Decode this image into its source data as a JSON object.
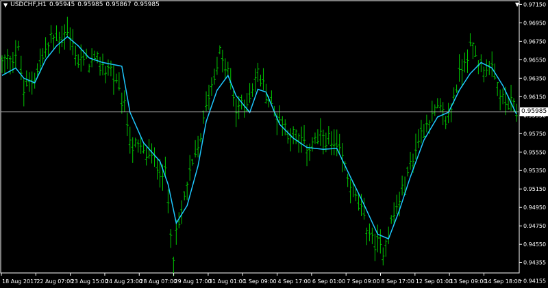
{
  "symbol": {
    "name": "USDCHF,H1",
    "ohlc": [
      "0.95945",
      "0.95985",
      "0.95867",
      "0.95985"
    ]
  },
  "current_price_label": "0.95985",
  "colors": {
    "background": "#000000",
    "bars": "#00c800",
    "moving_average": "#1ec8ff",
    "axis": "#ffffff",
    "price_line": "#c0c0c0"
  },
  "chart_data": {
    "type": "line",
    "title": "USDCHF,H1",
    "xlabel": "",
    "ylabel": "",
    "ylim": [
      0.9424,
      0.9719
    ],
    "current_price": 0.95985,
    "y_ticks": [
      "0.97150",
      "0.96950",
      "0.96750",
      "0.96550",
      "0.96350",
      "0.96150",
      "0.95950",
      "0.95750",
      "0.95550",
      "0.95350",
      "0.95150",
      "0.94950",
      "0.94750",
      "0.94550",
      "0.94355",
      "0.94155"
    ],
    "x_ticks": [
      "18 Aug 2017",
      "22 Aug 07:00",
      "23 Aug 15:00",
      "24 Aug 23:00",
      "28 Aug 07:00",
      "29 Aug 17:00",
      "31 Aug 01:00",
      "1 Sep 09:00",
      "4 Sep 17:00",
      "6 Sep 01:00",
      "7 Sep 09:00",
      "8 Sep 17:00",
      "12 Sep 01:00",
      "13 Sep 09:00",
      "14 Sep 18:00"
    ],
    "series": [
      {
        "name": "",
        "style": "hl_bars",
        "x_range": [
          0,
          189
        ],
        "anchors": [
          [
            0,
            0.965
          ],
          [
            6,
            0.9665
          ],
          [
            8,
            0.962
          ],
          [
            12,
            0.964
          ],
          [
            18,
            0.9675
          ],
          [
            24,
            0.9685
          ],
          [
            28,
            0.9655
          ],
          [
            35,
            0.965
          ],
          [
            40,
            0.9645
          ],
          [
            45,
            0.96
          ],
          [
            48,
            0.956
          ],
          [
            55,
            0.955
          ],
          [
            60,
            0.953
          ],
          [
            63,
            0.9445
          ],
          [
            68,
            0.952
          ],
          [
            72,
            0.956
          ],
          [
            76,
            0.962
          ],
          [
            80,
            0.966
          ],
          [
            83,
            0.964
          ],
          [
            86,
            0.96
          ],
          [
            90,
            0.961
          ],
          [
            94,
            0.964
          ],
          [
            100,
            0.96
          ],
          [
            106,
            0.9575
          ],
          [
            112,
            0.956
          ],
          [
            118,
            0.957
          ],
          [
            124,
            0.9555
          ],
          [
            128,
            0.952
          ],
          [
            132,
            0.949
          ],
          [
            136,
            0.946
          ],
          [
            140,
            0.945
          ],
          [
            143,
            0.948
          ],
          [
            148,
            0.952
          ],
          [
            152,
            0.956
          ],
          [
            156,
            0.959
          ],
          [
            160,
            0.96
          ],
          [
            164,
            0.959
          ],
          [
            168,
            0.964
          ],
          [
            172,
            0.967
          ],
          [
            176,
            0.965
          ],
          [
            180,
            0.964
          ],
          [
            184,
            0.961
          ],
          [
            189,
            0.96
          ]
        ]
      },
      {
        "name": "",
        "style": "line",
        "points": [
          [
            0,
            0.9638
          ],
          [
            5,
            0.9646
          ],
          [
            8,
            0.9635
          ],
          [
            12,
            0.963
          ],
          [
            16,
            0.9655
          ],
          [
            20,
            0.967
          ],
          [
            24,
            0.968
          ],
          [
            28,
            0.967
          ],
          [
            32,
            0.9657
          ],
          [
            37,
            0.9652
          ],
          [
            44,
            0.9648
          ],
          [
            47,
            0.9598
          ],
          [
            52,
            0.9565
          ],
          [
            58,
            0.9545
          ],
          [
            61,
            0.952
          ],
          [
            64,
            0.9478
          ],
          [
            68,
            0.9497
          ],
          [
            72,
            0.954
          ],
          [
            75,
            0.9588
          ],
          [
            79,
            0.9622
          ],
          [
            83,
            0.9638
          ],
          [
            86,
            0.9616
          ],
          [
            91,
            0.9598
          ],
          [
            94,
            0.9623
          ],
          [
            97,
            0.962
          ],
          [
            102,
            0.9585
          ],
          [
            107,
            0.957
          ],
          [
            112,
            0.956
          ],
          [
            118,
            0.9558
          ],
          [
            123,
            0.9559
          ],
          [
            128,
            0.9528
          ],
          [
            133,
            0.9498
          ],
          [
            138,
            0.9466
          ],
          [
            142,
            0.9461
          ],
          [
            146,
            0.9492
          ],
          [
            150,
            0.9528
          ],
          [
            155,
            0.9568
          ],
          [
            160,
            0.9593
          ],
          [
            164,
            0.9598
          ],
          [
            168,
            0.9622
          ],
          [
            172,
            0.964
          ],
          [
            176,
            0.9652
          ],
          [
            180,
            0.9646
          ],
          [
            184,
            0.9627
          ],
          [
            189,
            0.9596
          ]
        ]
      }
    ]
  }
}
